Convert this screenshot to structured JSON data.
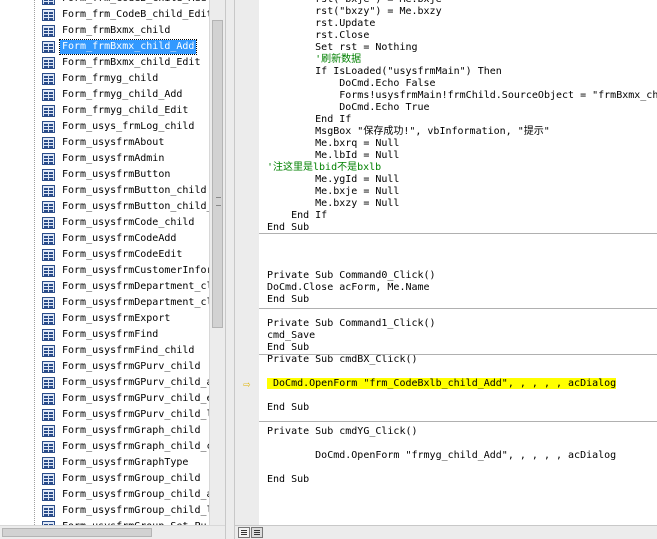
{
  "project_tree": {
    "items": [
      {
        "label": "Form_frm_CodeB_child_Add"
      },
      {
        "label": "Form_frm_CodeB_child_Edit"
      },
      {
        "label": "Form_frmBxmx_child"
      },
      {
        "label": "Form_frmBxmx_child_Add",
        "selected": true
      },
      {
        "label": "Form_frmBxmx_child_Edit"
      },
      {
        "label": "Form_frmyg_child"
      },
      {
        "label": "Form_frmyg_child_Add"
      },
      {
        "label": "Form_frmyg_child_Edit"
      },
      {
        "label": "Form_usys_frmLog_child"
      },
      {
        "label": "Form_usysfrmAbout"
      },
      {
        "label": "Form_usysfrmAdmin"
      },
      {
        "label": "Form_usysfrmButton"
      },
      {
        "label": "Form_usysfrmButton_child"
      },
      {
        "label": "Form_usysfrmButton_child_"
      },
      {
        "label": "Form_usysfrmCode_child"
      },
      {
        "label": "Form_usysfrmCodeAdd"
      },
      {
        "label": "Form_usysfrmCodeEdit"
      },
      {
        "label": "Form_usysfrmCustomerInfor"
      },
      {
        "label": "Form_usysfrmDepartment_cl"
      },
      {
        "label": "Form_usysfrmDepartment_cl"
      },
      {
        "label": "Form_usysfrmExport"
      },
      {
        "label": "Form_usysfrmFind"
      },
      {
        "label": "Form_usysfrmFind_child"
      },
      {
        "label": "Form_usysfrmGPurv_child"
      },
      {
        "label": "Form_usysfrmGPurv_child_a"
      },
      {
        "label": "Form_usysfrmGPurv_child_e"
      },
      {
        "label": "Form_usysfrmGPurv_child_l"
      },
      {
        "label": "Form_usysfrmGraph_child"
      },
      {
        "label": "Form_usysfrmGraph_child_c"
      },
      {
        "label": "Form_usysfrmGraphType"
      },
      {
        "label": "Form_usysfrmGroup_child"
      },
      {
        "label": "Form_usysfrmGroup_child_a"
      },
      {
        "label": "Form_usysfrmGroup_child_l"
      },
      {
        "label": "Form_usysfrmGroup_Set_Pu"
      }
    ]
  },
  "code_lines": [
    {
      "text": "        rst(\"bxje\") = Me.bxje"
    },
    {
      "text": "        rst(\"bxzy\") = Me.bxzy"
    },
    {
      "text": "        rst.Update"
    },
    {
      "text": "        rst.Close"
    },
    {
      "text": "        Set rst = Nothing"
    },
    {
      "text": "        '刷新数据",
      "comment": true
    },
    {
      "text": "        If IsLoaded(\"usysfrmMain\") Then"
    },
    {
      "text": "            DoCmd.Echo False"
    },
    {
      "text": "            Forms!usysfrmMain!frmChild.SourceObject = \"frmBxmx_child\""
    },
    {
      "text": "            DoCmd.Echo True"
    },
    {
      "text": "        End If"
    },
    {
      "text": "        MsgBox \"保存成功!\", vbInformation, \"提示\""
    },
    {
      "text": "        Me.bxrq = Null"
    },
    {
      "text": "        Me.lbId = Null"
    },
    {
      "text": "'注这里是lbid不是bxlb",
      "comment": true
    },
    {
      "text": "        Me.ygId = Null"
    },
    {
      "text": "        Me.bxje = Null"
    },
    {
      "text": "        Me.bxzy = Null"
    },
    {
      "text": "    End If"
    },
    {
      "text": "End Sub"
    },
    {
      "text": ""
    },
    {
      "text": ""
    },
    {
      "text": ""
    },
    {
      "text": "Private Sub Command0_Click()"
    },
    {
      "text": "DoCmd.Close acForm, Me.Name"
    },
    {
      "text": "End Sub"
    },
    {
      "text": ""
    },
    {
      "text": "Private Sub Command1_Click()"
    },
    {
      "text": "cmd_Save"
    },
    {
      "text": "End Sub"
    },
    {
      "text": "Private Sub cmdBX_Click()"
    },
    {
      "text": ""
    },
    {
      "text": " DoCmd.OpenForm \"frm_CodeBxlb_child_Add\", , , , , acDialog",
      "highlight": true
    },
    {
      "text": ""
    },
    {
      "text": "End Sub"
    },
    {
      "text": ""
    },
    {
      "text": "Private Sub cmdYG_Click()"
    },
    {
      "text": ""
    },
    {
      "text": "        DoCmd.OpenForm \"frmyg_child_Add\", , , , , acDialog"
    },
    {
      "text": ""
    },
    {
      "text": "End Sub"
    }
  ]
}
